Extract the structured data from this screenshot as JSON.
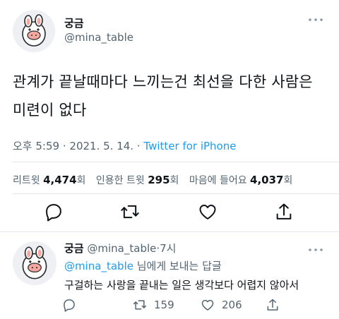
{
  "tweet": {
    "author_name": "궁금",
    "author_handle": "@mina_table",
    "text": "관계가 끝날때마다 느끼는건 최선을 다한 사람은 미련이 없다",
    "time": "오후 5:59",
    "date": "2021. 5. 14.",
    "separator": "·",
    "source": "Twitter for iPhone",
    "stats": {
      "retweets_label": "리트윗",
      "retweets_count": "4,474",
      "retweets_unit": "회",
      "quotes_label": "인용한 트윗",
      "quotes_count": "295",
      "quotes_unit": "회",
      "likes_label": "마음에 들어요",
      "likes_count": "4,037",
      "likes_unit": "회"
    },
    "actions": [
      "reply-icon",
      "retweet-icon",
      "like-icon",
      "share-icon"
    ]
  },
  "reply": {
    "author_name": "궁금",
    "author_handle": "@mina_table",
    "separator": "·",
    "time": "7시",
    "reply_to_handle": "@mina_table",
    "reply_to_suffix": "님에게 보내는 답글",
    "text": "구걸하는 사랑을 끝내는 일은 생각보다 어렵지 않아서",
    "retweet_count": "159",
    "like_count": "206"
  },
  "colors": {
    "accent": "#1d9bf0",
    "muted": "#536471",
    "text": "#0f1419",
    "avatar_pink": "#f5a7a0"
  }
}
